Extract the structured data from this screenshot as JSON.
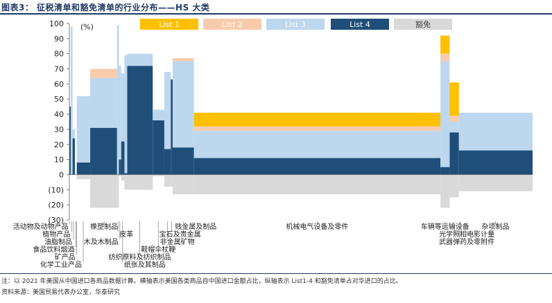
{
  "figure": {
    "title": "图表3： 征税清单和豁免清单的行业分布——HS 大类",
    "note": "注：以 2021 年美国从中国进口各商品数据计算。横轴表示美国各类商品自中国进口金额占比，纵轴表示 List1-4 和豁免清单占对华进口的占比。",
    "source": "资料来源：美国贸易代表办公室，华泰研究"
  },
  "colors": {
    "list1": "#ffc000",
    "list2": "#f8cbad",
    "list3": "#bdd7ee",
    "list4": "#1f4e79",
    "exempt": "#d9d9d9",
    "text": "#1f3864"
  },
  "chart_data": {
    "type": "bar",
    "subtype": "variable-width stacked bar (Marimekko)",
    "yunit": "(%)",
    "ylim": [
      -30,
      100
    ],
    "yticks": [
      "(30)",
      "(20)",
      "(10)",
      "0",
      "10",
      "20",
      "30",
      "40",
      "50",
      "60",
      "70",
      "80",
      "90",
      "100"
    ],
    "xlim": [
      0,
      100
    ],
    "legend": [
      "List 1",
      "List 2",
      "List 3",
      "List 4",
      "豁免"
    ],
    "legend_position": "top",
    "series_keys": [
      "list4",
      "list3",
      "list2",
      "list1"
    ],
    "segments": [
      {
        "x0": 0.0,
        "x1": 0.3,
        "list4": 45,
        "list3": 0,
        "list2": 0,
        "list1": 0,
        "exempt": 0
      },
      {
        "x0": 0.3,
        "x1": 0.7,
        "list4": 0,
        "list3": 98,
        "list2": 0,
        "list1": 0,
        "exempt": 0
      },
      {
        "x0": 0.7,
        "x1": 1.2,
        "list4": 24,
        "list3": 6,
        "list2": 0,
        "list1": 0,
        "exempt": 0
      },
      {
        "x0": 1.2,
        "x1": 1.6,
        "list4": 0,
        "list3": 0,
        "list2": 0,
        "list1": 0,
        "exempt": 0
      },
      {
        "x0": 1.6,
        "x1": 4.5,
        "list4": 8,
        "list3": 44,
        "list2": 0,
        "list1": 0,
        "exempt": -3
      },
      {
        "x0": 4.5,
        "x1": 10.3,
        "list4": 31,
        "list3": 33,
        "list2": 6,
        "list1": 0,
        "exempt": -22
      },
      {
        "x0": 10.3,
        "x1": 10.7,
        "list4": 0,
        "list3": 99,
        "list2": 0,
        "list1": 0,
        "exempt": -22
      },
      {
        "x0": 10.7,
        "x1": 11.2,
        "list4": 10,
        "list3": 62,
        "list2": 0,
        "list1": 0,
        "exempt": -1
      },
      {
        "x0": 11.2,
        "x1": 11.9,
        "list4": 22,
        "list3": 45,
        "list2": 0,
        "list1": 0,
        "exempt": -4
      },
      {
        "x0": 11.9,
        "x1": 12.5,
        "list4": 1,
        "list3": 78,
        "list2": 0,
        "list1": 0,
        "exempt": -10
      },
      {
        "x0": 12.5,
        "x1": 18.0,
        "list4": 72,
        "list3": 8,
        "list2": 0,
        "list1": 0,
        "exempt": -10
      },
      {
        "x0": 18.0,
        "x1": 20.5,
        "list4": 36,
        "list3": 7,
        "list2": 0,
        "list1": 0,
        "exempt": -1
      },
      {
        "x0": 20.5,
        "x1": 21.9,
        "list4": 17,
        "list3": 51,
        "list2": 0,
        "list1": 0,
        "exempt": -8
      },
      {
        "x0": 21.9,
        "x1": 22.3,
        "list4": 63,
        "list3": 0,
        "list2": 0,
        "list1": 0,
        "exempt": -8
      },
      {
        "x0": 22.3,
        "x1": 26.9,
        "list4": 18,
        "list3": 57,
        "list2": 2,
        "list1": 0,
        "exempt": -13
      },
      {
        "x0": 26.9,
        "x1": 80.1,
        "list4": 11,
        "list3": 18,
        "list2": 3,
        "list1": 9,
        "exempt": -13
      },
      {
        "x0": 80.1,
        "x1": 82.1,
        "list4": 5,
        "list3": 70,
        "list2": 5,
        "list1": 12,
        "exempt": -22
      },
      {
        "x0": 82.1,
        "x1": 84.1,
        "list4": 28,
        "list3": 7,
        "list2": 4,
        "list1": 22,
        "exempt": -15
      },
      {
        "x0": 84.1,
        "x1": 100.0,
        "list4": 16,
        "list3": 25,
        "list2": 0,
        "list1": 0,
        "exempt": -11
      }
    ],
    "category_labels": [
      {
        "text": "活动物及动物产品",
        "x": 0.1
      },
      {
        "text": "植物产品",
        "x": 0.5
      },
      {
        "text": "油脂制品",
        "x": 0.9
      },
      {
        "text": "食品饮料烟酒",
        "x": 1.4
      },
      {
        "text": "矿产品",
        "x": 1.6
      },
      {
        "text": "化学工业产品",
        "x": 3.0
      },
      {
        "text": "橡塑制品",
        "x": 7.5
      },
      {
        "text": "皮革",
        "x": 10.5
      },
      {
        "text": "木及木制品",
        "x": 10.9
      },
      {
        "text": "纸张及其制品",
        "x": 11.5
      },
      {
        "text": "纺织原料及纺织制品",
        "x": 15.2
      },
      {
        "text": "鞋帽伞杖鞭",
        "x": 19.2
      },
      {
        "text": "非金属矿物",
        "x": 21.2
      },
      {
        "text": "宝石及贵金属",
        "x": 22.1
      },
      {
        "text": "贱金属及制品",
        "x": 24.6
      },
      {
        "text": "机械电气设备及零件",
        "x": 53.5
      },
      {
        "text": "车辆等运输设备",
        "x": 81.1
      },
      {
        "text": "光学照相电影计量",
        "x": 83.1
      },
      {
        "text": "武器弹药及零附件",
        "x": 84.3
      },
      {
        "text": "杂项制品",
        "x": 92.0
      }
    ]
  }
}
